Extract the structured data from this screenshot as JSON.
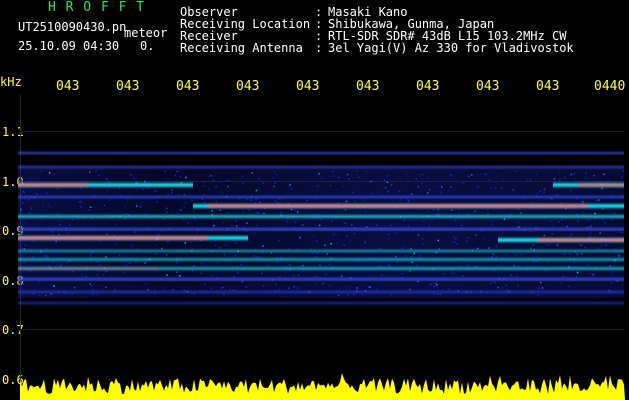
{
  "header": {
    "title": "H R O F F T",
    "filename": "UT2510090430.pn",
    "mode": "meteor",
    "datetime": "25.10.09 04:30",
    "count": "0.",
    "fields": [
      {
        "label": "Observer",
        "value": "Masaki Kano"
      },
      {
        "label": "Receiving Location",
        "value": "Shibukawa, Gunma, Japan"
      },
      {
        "label": "Receiver",
        "value": "RTL-SDR SDR# 43dB L15 103.2MHz CW"
      },
      {
        "label": "Receiving Antenna",
        "value": "3el Yagi(V) Az 330 for Vladivostok"
      }
    ],
    "separator": ":"
  },
  "axis": {
    "unit": "kHz",
    "y_ticks": [
      "1.1",
      "1.0",
      "0.9",
      "0.8",
      "0.7",
      "0.6"
    ],
    "time_ticks": [
      "043",
      "043",
      "043",
      "043",
      "043",
      "043",
      "043",
      "043",
      "043",
      "0440"
    ]
  },
  "colors": {
    "background": "#000000",
    "header_text": "#ffffff",
    "title": "#27e83b",
    "time_labels": "#ffff3a",
    "signal_low": "#1a2bd8",
    "signal_mid": "#1fd3e0",
    "signal_high": "#ff2020",
    "noise_band": "#ffff00"
  }
}
